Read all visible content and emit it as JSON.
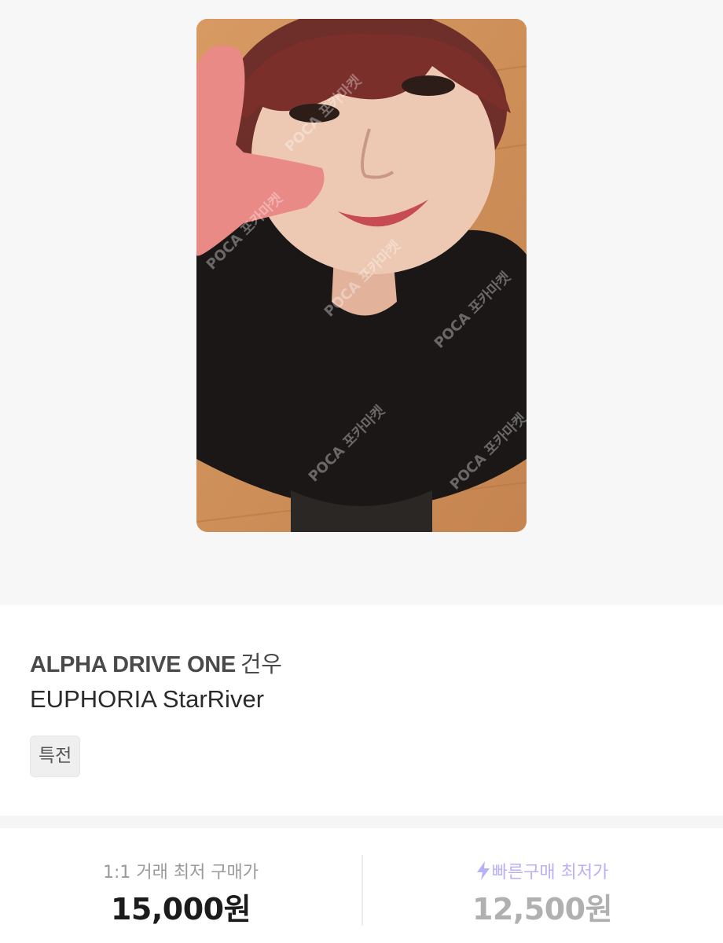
{
  "product": {
    "group": "ALPHA DRIVE ONE",
    "member": "건우",
    "album": "EUPHORIA StarRiver",
    "tag": "특전",
    "image_watermark": "POCA 포카마켓"
  },
  "prices": {
    "one_to_one_label": "1:1 거래 최저 구매가",
    "one_to_one_value": "15,000원",
    "quick_buy_label": "빠른구매 최저가",
    "quick_buy_value": "12,500원"
  },
  "colors": {
    "accent": "#b9b1f5",
    "price_muted": "#b0b0b0"
  },
  "icons": {
    "quick_buy": "lightning-bolt-icon"
  }
}
